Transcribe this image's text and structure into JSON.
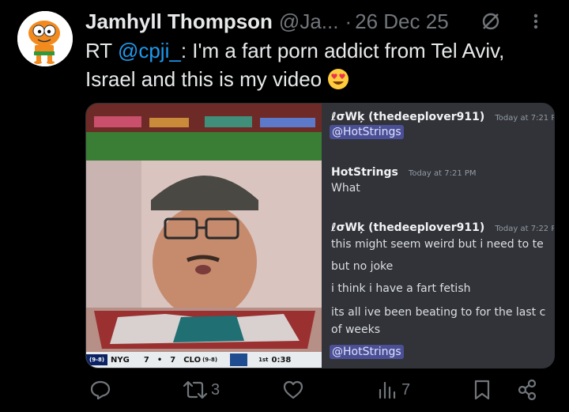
{
  "author": {
    "name": "Jamhyll Thompson",
    "handle": "@Ja...",
    "separator": "·",
    "date": "26 Dec 25"
  },
  "tweet": {
    "prefix": "RT ",
    "mention": "@cpji_",
    "body": ": I'm a fart porn addict from Tel Aviv, Israel and this is my video",
    "emoji": "😍"
  },
  "video": {
    "scoreboard": {
      "team1_record": "(9-8)",
      "team1": "NYG",
      "score1": "7",
      "separator": "•",
      "score2": "7",
      "team2": "CLO",
      "team2_record": "(9-8)",
      "quarter": "1st",
      "clock": "0:38"
    }
  },
  "chat": {
    "messages": [
      {
        "author": "ℓσWķ (thedeeplover911)",
        "time": "Today at 7:21 P",
        "lines": [
          "@HotStrings"
        ]
      },
      {
        "author": "HotStrings",
        "time": "Today at 7:21 PM",
        "lines": [
          "What"
        ]
      },
      {
        "author": "ℓσWķ (thedeeplover911)",
        "time": "Today at 7:22 P",
        "lines": [
          "this might seem weird but i need to te",
          "but no joke",
          "i think i have a fart fetish",
          "its all ive been beating to for the last c",
          "of weeks",
          "@HotStrings"
        ]
      }
    ]
  },
  "actions": {
    "replies": "",
    "retweets": "3",
    "likes": "",
    "views": "7"
  },
  "colors": {
    "background": "#000000",
    "text": "#e7e9ea",
    "muted": "#71767b",
    "link": "#1d9bf0",
    "discord_bg": "#313338",
    "mention_bg": "#4b5096"
  }
}
